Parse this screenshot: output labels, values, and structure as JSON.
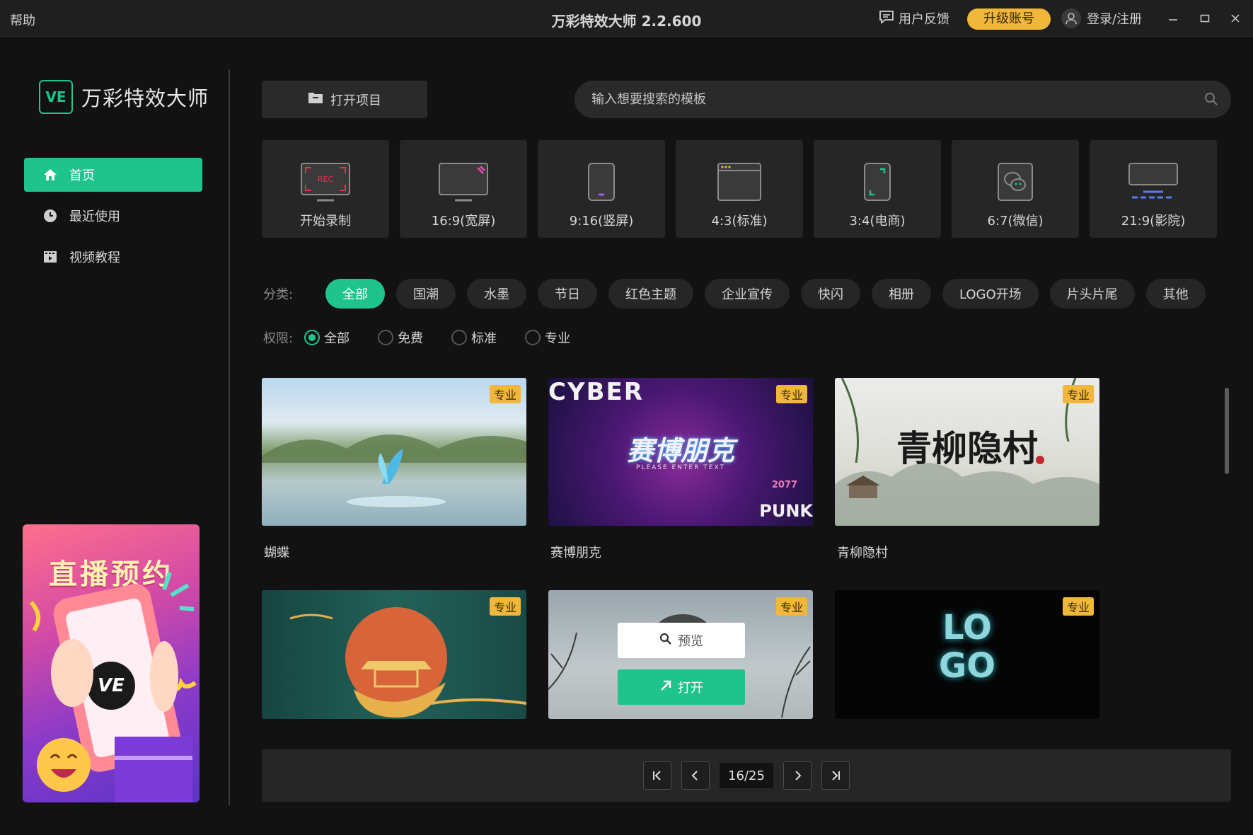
{
  "titlebar": {
    "help": "帮助",
    "title": "万彩特效大师 2.2.600",
    "feedback": "用户反馈",
    "upgrade": "升级账号",
    "login": "登录/注册"
  },
  "sidebar": {
    "logo_badge": "VE",
    "logo_text": "万彩特效大师",
    "items": [
      {
        "label": "首页",
        "icon": "home-icon",
        "active": true
      },
      {
        "label": "最近使用",
        "icon": "clock-icon",
        "active": false
      },
      {
        "label": "视频教程",
        "icon": "film-icon",
        "active": false
      }
    ],
    "banner_title": "直播预约",
    "banner_badge": "VE"
  },
  "toolbar": {
    "open_project": "打开项目",
    "search_placeholder": "输入想要搜索的模板"
  },
  "ratios": [
    {
      "label": "开始录制",
      "icon": "record-screen-icon"
    },
    {
      "label": "16:9(宽屏)",
      "icon": "widescreen-icon"
    },
    {
      "label": "9:16(竖屏)",
      "icon": "portrait-phone-icon"
    },
    {
      "label": "4:3(标准)",
      "icon": "standard-window-icon"
    },
    {
      "label": "3:4(电商)",
      "icon": "ecommerce-phone-icon"
    },
    {
      "label": "6:7(微信)",
      "icon": "wechat-icon"
    },
    {
      "label": "21:9(影院)",
      "icon": "cinema-icon"
    }
  ],
  "filters": {
    "category_label": "分类:",
    "categories": [
      "全部",
      "国潮",
      "水墨",
      "节日",
      "红色主题",
      "企业宣传",
      "快闪",
      "相册",
      "LOGO开场",
      "片头片尾",
      "其他"
    ],
    "permission_label": "权限:",
    "permissions": [
      "全部",
      "免费",
      "标准",
      "专业"
    ]
  },
  "templates": [
    {
      "title": "蝴蝶",
      "badge": "专业"
    },
    {
      "title": "赛博朋克",
      "badge": "专业",
      "thumb_text": "赛博朋克",
      "thumb_top": "CYBER",
      "thumb_sub": "PLEASE ENTER TEXT",
      "thumb_year": "2077",
      "thumb_corner": "PUNK"
    },
    {
      "title": "青柳隐村",
      "badge": "专业",
      "thumb_text": "青柳隐村"
    },
    {
      "title": "",
      "badge": "专业"
    },
    {
      "title": "",
      "badge": "专业"
    },
    {
      "title": "",
      "badge": "专业",
      "thumb_text": "LO GO"
    }
  ],
  "hover": {
    "preview": "预览",
    "open": "打开"
  },
  "pager": {
    "current": "16/25"
  },
  "colors": {
    "accent": "#1fc48d",
    "gold": "#f0b73a",
    "bg": "#121212",
    "panel": "#262626"
  }
}
